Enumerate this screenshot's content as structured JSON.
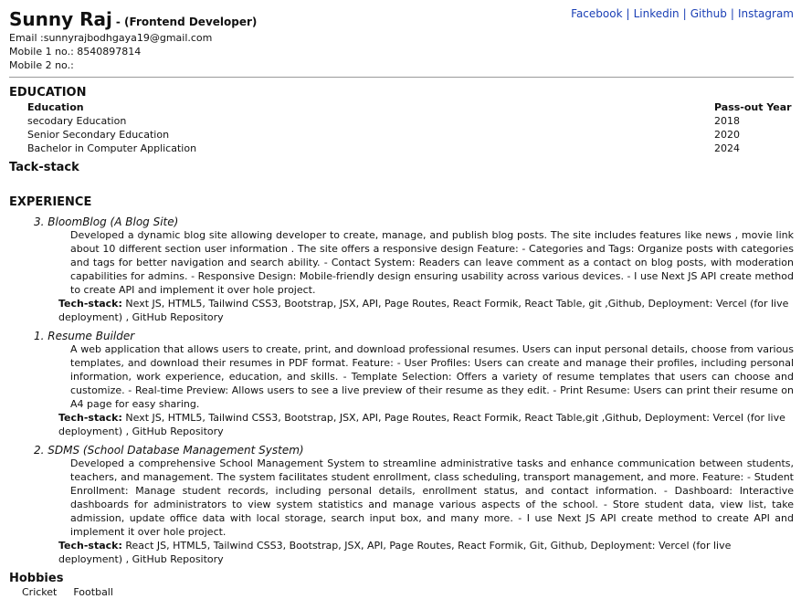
{
  "header": {
    "name": "Sunny Raj",
    "role": "- (Frontend Developer)",
    "email": "Email :sunnyrajbodhgaya19@gmail.com",
    "mobile1": "Mobile 1 no.: 8540897814",
    "mobile2": "Mobile 2 no.:",
    "social": [
      "Facebook",
      "Linkedin",
      "Github",
      "Instagram"
    ],
    "social_sep": "|"
  },
  "education": {
    "heading": "EDUCATION",
    "col_education": "Education",
    "col_year": "Pass-out Year",
    "rows": [
      {
        "name": "secodary Education",
        "year": "2018"
      },
      {
        "name": "Senior Secondary Education",
        "year": "2020"
      },
      {
        "name": "Bachelor in Computer Application",
        "year": "2024"
      }
    ]
  },
  "techstack_heading": "Tack-stack",
  "experience": {
    "heading": "EXPERIENCE",
    "stack_label": "Tech-stack:",
    "projects": [
      {
        "title": "3. BloomBlog (A Blog Site)",
        "description": "Developed a dynamic blog site allowing developer to create, manage, and publish blog posts. The site includes features like news , movie link about 10 different section user information . The site offers a responsive design Feature: - Categories and Tags: Organize posts with categories and tags for better navigation and search ability. - Contact System: Readers can leave comment as a contact on blog posts, with moderation capabilities for admins. - Responsive Design: Mobile-friendly design ensuring usability across various devices. - I use Next JS API create method to create API and implement it over hole project.",
        "stack": "Next JS, HTML5, Tailwind CSS3, Bootstrap, JSX, API, Page Routes, React Formik, React Table, git ,Github, Deployment: Vercel (for live deployment) , GitHub Repository"
      },
      {
        "title": "1. Resume Builder",
        "description": "A web application that allows users to create, print, and download professional resumes. Users can input personal details, choose from various templates, and download their resumes in PDF format. Feature: - User Profiles: Users can create and manage their profiles, including personal information, work experience, education, and skills. - Template Selection: Offers a variety of resume templates that users can choose and customize. - Real-time Preview: Allows users to see a live preview of their resume as they edit. - Print Resume: Users can print their resume on A4 page for easy sharing.",
        "stack": "Next JS, HTML5, Tailwind CSS3, Bootstrap, JSX, API, Page Routes, React Formik, React Table,git ,Github, Deployment: Vercel (for live deployment) , GitHub Repository"
      },
      {
        "title": "2. SDMS (School Database Management System)",
        "description": "Developed a comprehensive School Management System to streamline administrative tasks and enhance communication between students, teachers, and management. The system facilitates student enrollment, class scheduling, transport management, and more. Feature: - Student Enrollment: Manage student records, including personal details, enrollment status, and contact information. - Dashboard: Interactive dashboards for administrators to view system statistics and manage various aspects of the school. - Store student data, view list, take admission, update office data with local storage, search input box, and many more. - I use Next JS API create method to create API and implement it over hole project.",
        "stack": "React JS, HTML5, Tailwind CSS3, Bootstrap, JSX, API, Page Routes, React Formik, Git, Github, Deployment: Vercel (for live deployment) , GitHub Repository"
      }
    ]
  },
  "hobbies": {
    "heading": "Hobbies",
    "items": [
      "Cricket",
      "Football"
    ]
  },
  "colors": {
    "link": "#1a3fb5",
    "text": "#111111",
    "rule": "#999999"
  }
}
